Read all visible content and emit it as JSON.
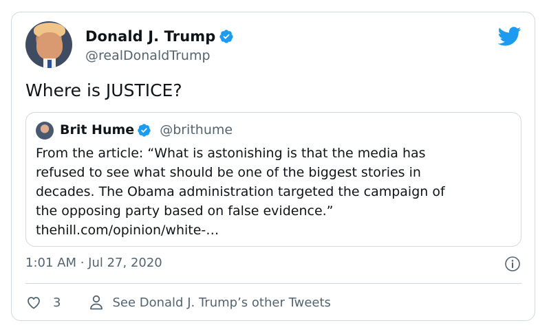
{
  "tweet": {
    "author": {
      "display_name": "Donald J. Trump",
      "handle": "@realDonaldTrump",
      "verified": true
    },
    "text": "Where is JUSTICE?",
    "quoted_tweet": {
      "author": {
        "display_name": "Brit Hume",
        "handle": "@brithume",
        "verified": true
      },
      "lines": [
        "From the article: “What is astonishing is that the media has",
        "refused to see what should be one of the biggest stories in",
        "decades. The Obama administration targeted the campaign of",
        "the opposing party based on false evidence.”",
        "thehill.com/opinion/white-…"
      ]
    },
    "timestamp": "1:01 AM · Jul 27, 2020",
    "like_count": "3",
    "other_tweets_label": "See Donald J. Trump’s other Tweets"
  },
  "colors": {
    "twitter_blue": "#1d9bf0",
    "secondary_text": "#536471",
    "border": "#cfd9de"
  },
  "icons": {
    "logo": "twitter-bird-icon",
    "verified": "verified-badge-icon",
    "info": "info-icon",
    "like": "heart-icon",
    "profile": "person-icon"
  }
}
